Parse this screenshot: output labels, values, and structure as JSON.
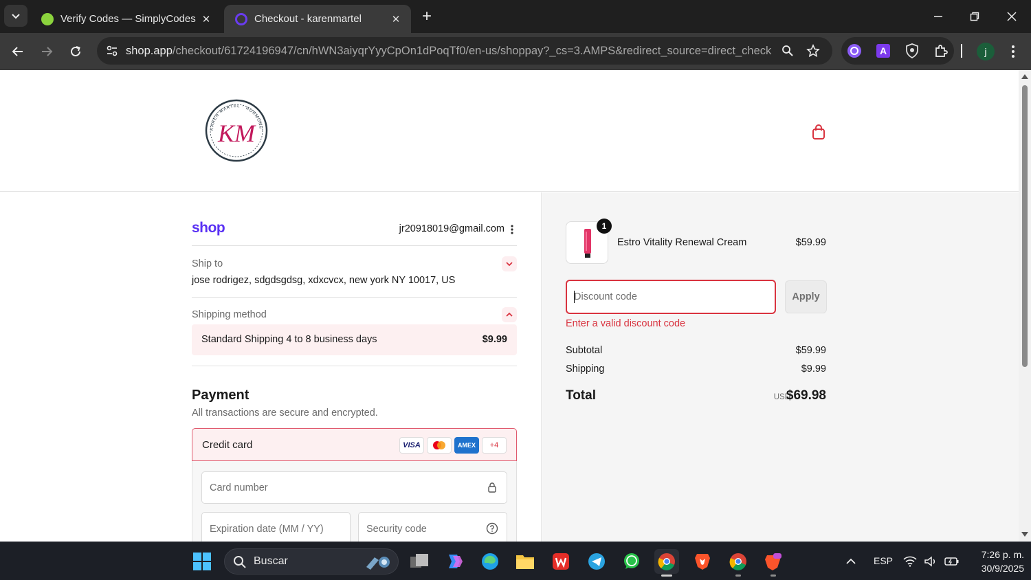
{
  "browser": {
    "tabs": [
      {
        "title": "Verify Codes — SimplyCodes",
        "favicon": "simplycodes-icon",
        "active": false
      },
      {
        "title": "Checkout - karenmartel",
        "favicon": "shop-icon",
        "active": true
      }
    ],
    "url_domain": "shop.app",
    "url_path": "/checkout/61724196947/cn/hWN3aiyqrYyyCpOn1dPoqTf0/en-us/shoppay?_cs=3.AMPS&redirect_source=direct_check...",
    "profile_initial": "j"
  },
  "page": {
    "brand_logo_alt": "Karen Martel Hormone Solutions",
    "brand_logo_letters": "KM",
    "brand_logo_ring_text": "KAREN MARTEL · HORMONE SOLUTIONS",
    "shop_wordmark": "shop",
    "account_email": "jr20918019@gmail.com",
    "ship_to": {
      "label": "Ship to",
      "address": "jose rodrigez, sdgdsgdsg, xdxcvcx, new york NY 10017, US"
    },
    "shipping_method": {
      "label": "Shipping method",
      "option": "Standard Shipping 4 to 8 business days",
      "price": "$9.99"
    },
    "payment": {
      "title": "Payment",
      "subtitle": "All transactions are secure and encrypted.",
      "method_label": "Credit card",
      "brands": [
        "VISA",
        "",
        "AMEX",
        "+4"
      ],
      "card_number_placeholder": "Card number",
      "expiry_placeholder": "Expiration date (MM / YY)",
      "security_placeholder": "Security code"
    }
  },
  "summary": {
    "item": {
      "name": "Estro Vitality Renewal Cream",
      "price": "$59.99",
      "quantity": "1"
    },
    "discount": {
      "placeholder": "Discount code",
      "value": "",
      "apply_label": "Apply",
      "error": "Enter a valid discount code"
    },
    "subtotal_label": "Subtotal",
    "subtotal": "$59.99",
    "shipping_label": "Shipping",
    "shipping": "$9.99",
    "total_label": "Total",
    "currency": "USD",
    "total": "$69.98"
  },
  "taskbar": {
    "search_label": "Buscar",
    "language": "ESP",
    "time": "7:26 p. m.",
    "date": "30/9/2025"
  },
  "colors": {
    "accent_red": "#d9333f",
    "shop_purple": "#5a31f4",
    "shipping_bg": "#fdf0f1"
  }
}
